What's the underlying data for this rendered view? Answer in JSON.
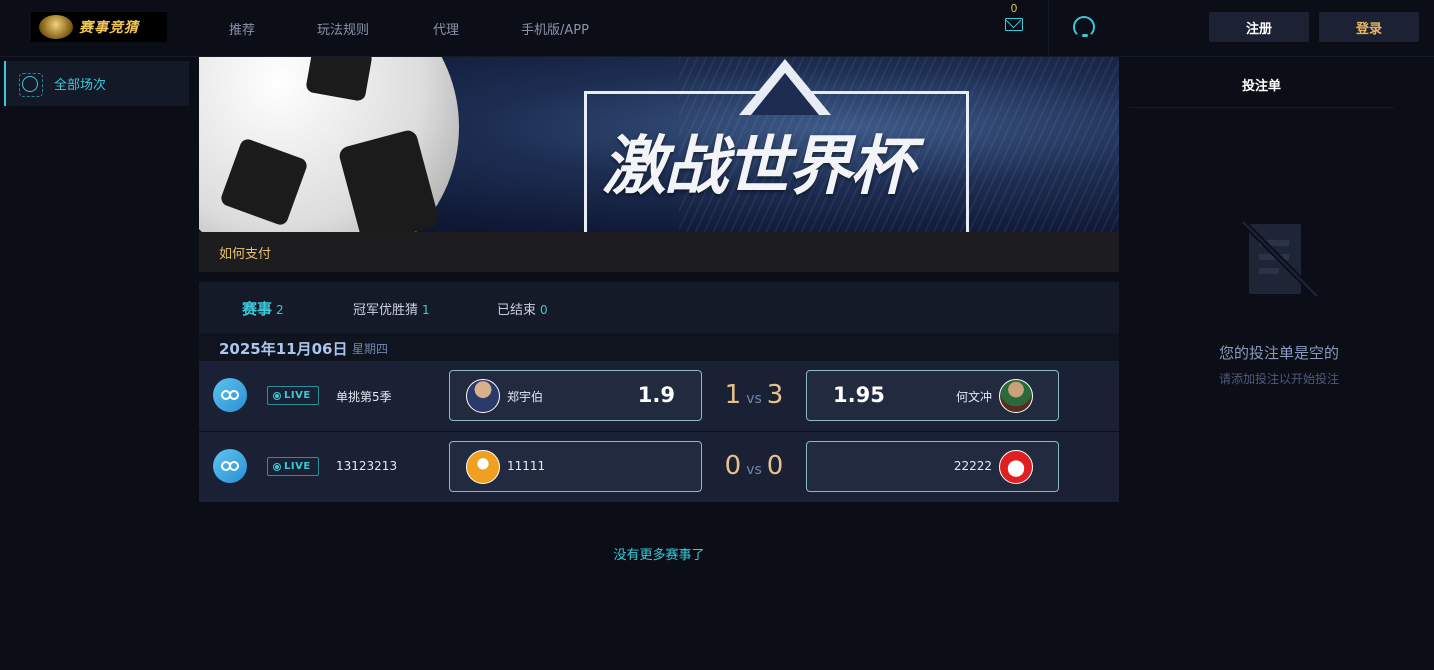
{
  "header": {
    "logo_text": "赛事竞猜",
    "nav": [
      "推荐",
      "玩法规则",
      "代理",
      "手机版/APP"
    ],
    "mail_count": "0",
    "register_label": "注册",
    "login_label": "登录"
  },
  "sidebar": {
    "items": [
      {
        "label": "全部场次",
        "icon": "target-icon"
      }
    ]
  },
  "banner": {
    "headline": "激战世界杯",
    "pay_link": "如何支付"
  },
  "tabs": [
    {
      "label": "赛事",
      "count": "2"
    },
    {
      "label": "冠军优胜猜",
      "count": "1"
    },
    {
      "label": "已结束",
      "count": "0"
    }
  ],
  "date_group": {
    "date": "2025年11月06日",
    "weekday": "星期四"
  },
  "matches": [
    {
      "live_label": "LIVE",
      "league": "单挑第5季",
      "home": {
        "name": "郑宇伯",
        "odds": "1.9"
      },
      "score_home": "1",
      "vs": "vs",
      "score_away": "3",
      "away": {
        "name": "何文冲",
        "odds": "1.95"
      }
    },
    {
      "live_label": "LIVE",
      "league": "13123213",
      "home": {
        "name": "11111",
        "odds": ""
      },
      "score_home": "0",
      "vs": "vs",
      "score_away": "0",
      "away": {
        "name": "22222",
        "odds": ""
      }
    }
  ],
  "footer_note": "没有更多赛事了",
  "betslip": {
    "title": "投注单",
    "empty_title": "您的投注单是空的",
    "empty_sub": "请添加投注以开始投注"
  },
  "colors": {
    "accent": "#3bc8d8",
    "gold": "#e8c070",
    "background": "#0b0e17"
  }
}
